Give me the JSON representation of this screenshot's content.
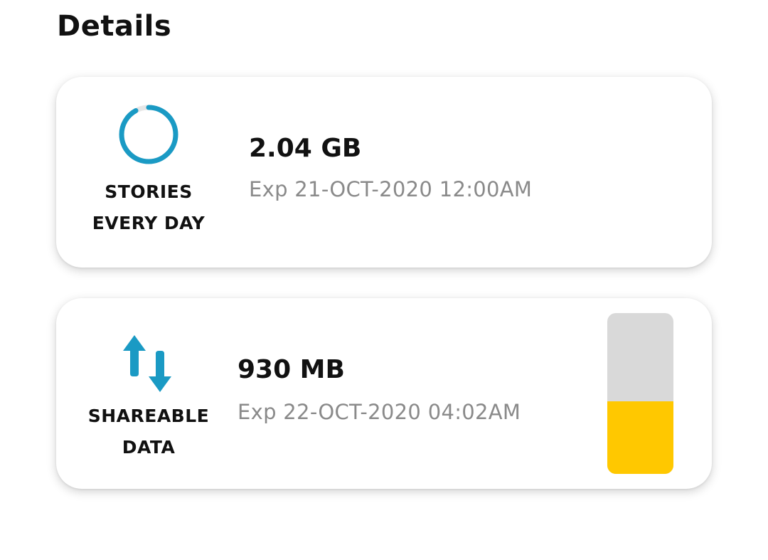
{
  "section": {
    "title": "Details"
  },
  "cards": [
    {
      "icon": "progress-ring-icon",
      "label_line1": "STORIES",
      "label_line2": "EVERY DAY",
      "amount": "2.04 GB",
      "expiry": "Exp 21-OCT-2020 12:00AM",
      "ring_fraction": 0.92,
      "ring_color": "#1a9ac4",
      "ring_track_color": "#e6e6e6"
    },
    {
      "icon": "up-down-arrows-icon",
      "label_line1": "SHAREABLE",
      "label_line2": "DATA",
      "amount": "930 MB",
      "expiry": "Exp 22-OCT-2020 04:02AM",
      "meter_fraction": 0.45,
      "meter_fill_color": "#ffc800",
      "meter_track_color": "#d9d9d9",
      "arrow_color": "#1a9ac4"
    }
  ]
}
